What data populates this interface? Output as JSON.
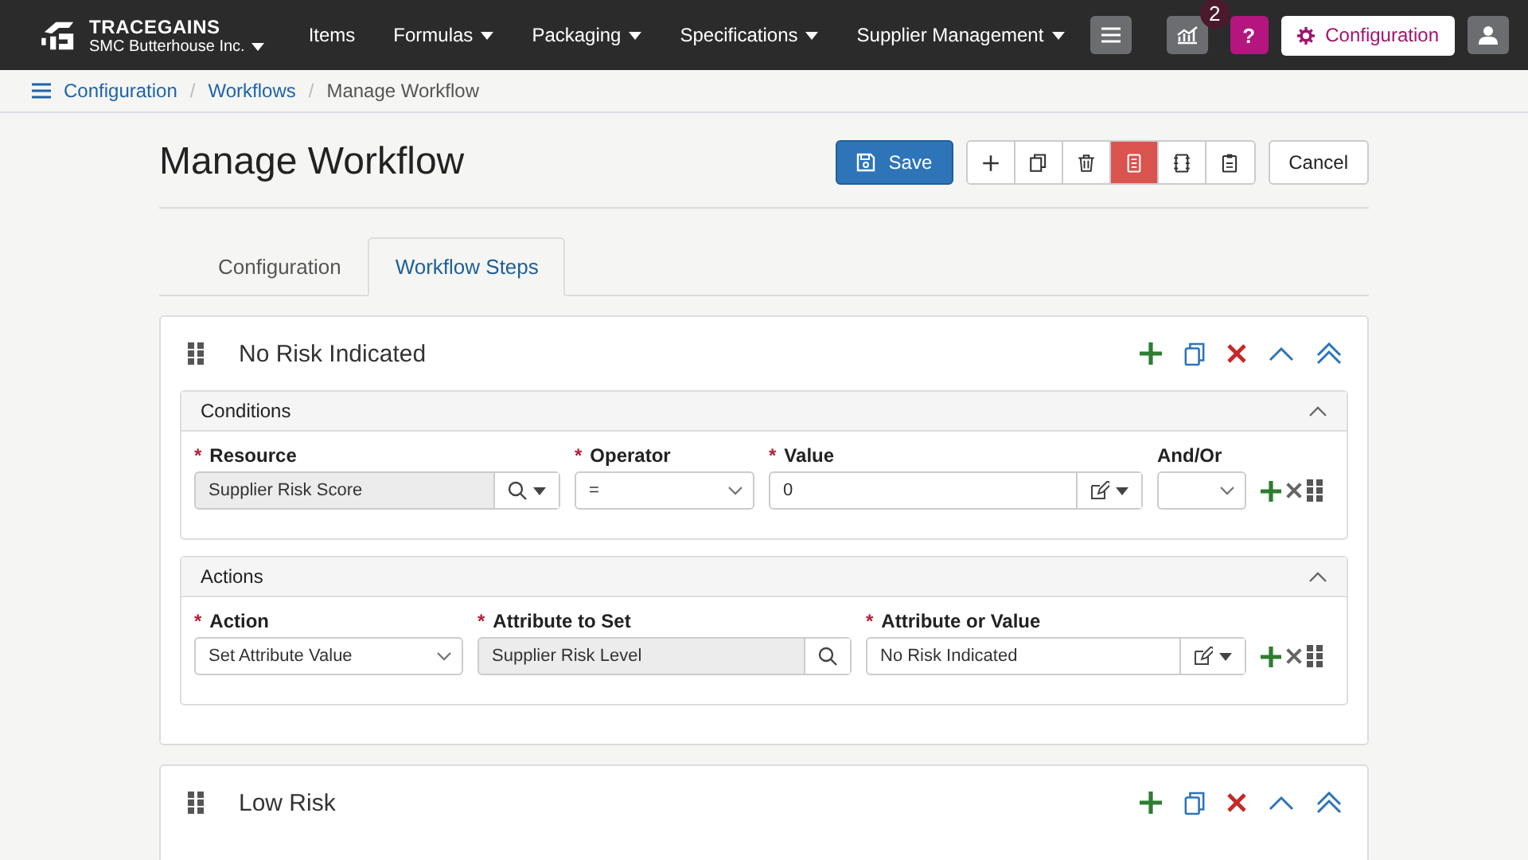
{
  "header": {
    "brand": "TRACEGAINS",
    "company": "SMC Butterhouse Inc.",
    "nav": [
      {
        "label": "Items",
        "dropdown": false
      },
      {
        "label": "Formulas",
        "dropdown": true
      },
      {
        "label": "Packaging",
        "dropdown": true
      },
      {
        "label": "Specifications",
        "dropdown": true
      },
      {
        "label": "Supplier Management",
        "dropdown": true
      }
    ],
    "notification_count": "2",
    "help": "?",
    "config_button": "Configuration"
  },
  "breadcrumb": [
    {
      "label": "Configuration",
      "link": true
    },
    {
      "separator": "/",
      "label": "Workflows",
      "link": true
    },
    {
      "separator": "/",
      "label": "Manage Workflow",
      "link": false
    }
  ],
  "title": "Manage Workflow",
  "save_button": "Save",
  "toolbar": [
    {
      "kind": "add",
      "active": false
    },
    {
      "kind": "copy",
      "active": false
    },
    {
      "kind": "delete",
      "active": false
    },
    {
      "kind": "document",
      "active": true
    },
    {
      "kind": "notebook",
      "active": false
    },
    {
      "kind": "clipboard",
      "active": false
    }
  ],
  "cancel_button": "Cancel",
  "tabs": [
    {
      "label": "Configuration",
      "selected": false
    },
    {
      "label": "Workflow Steps",
      "selected": true
    }
  ],
  "steps": [
    {
      "title": "No Risk Indicated",
      "sections": [
        {
          "title": "Conditions",
          "expanded": true,
          "fields": [
            {
              "required_mark": "*",
              "label": "Resource",
              "kind": "lookup",
              "value": "Supplier Risk Score",
              "readonly": true
            },
            {
              "required_mark": "*",
              "label": "Operator",
              "kind": "select",
              "value": "=",
              "readonly": false
            },
            {
              "required_mark": "*",
              "label": "Value",
              "kind": "edit",
              "value": "0",
              "readonly": false
            },
            {
              "label": "And/Or",
              "kind": "select",
              "readonly": false
            }
          ]
        },
        {
          "title": "Actions",
          "expanded": true,
          "fields": [
            {
              "required_mark": "*",
              "label": "Action",
              "kind": "select",
              "value": "Set Attribute Value",
              "readonly": false
            },
            {
              "required_mark": "*",
              "label": "Attribute to Set",
              "kind": "search",
              "value": "Supplier Risk Level",
              "readonly": true
            },
            {
              "required_mark": "*",
              "label": "Attribute or Value",
              "kind": "edit",
              "value": "No Risk Indicated",
              "readonly": false
            }
          ]
        }
      ]
    },
    {
      "title": "Low Risk"
    }
  ]
}
